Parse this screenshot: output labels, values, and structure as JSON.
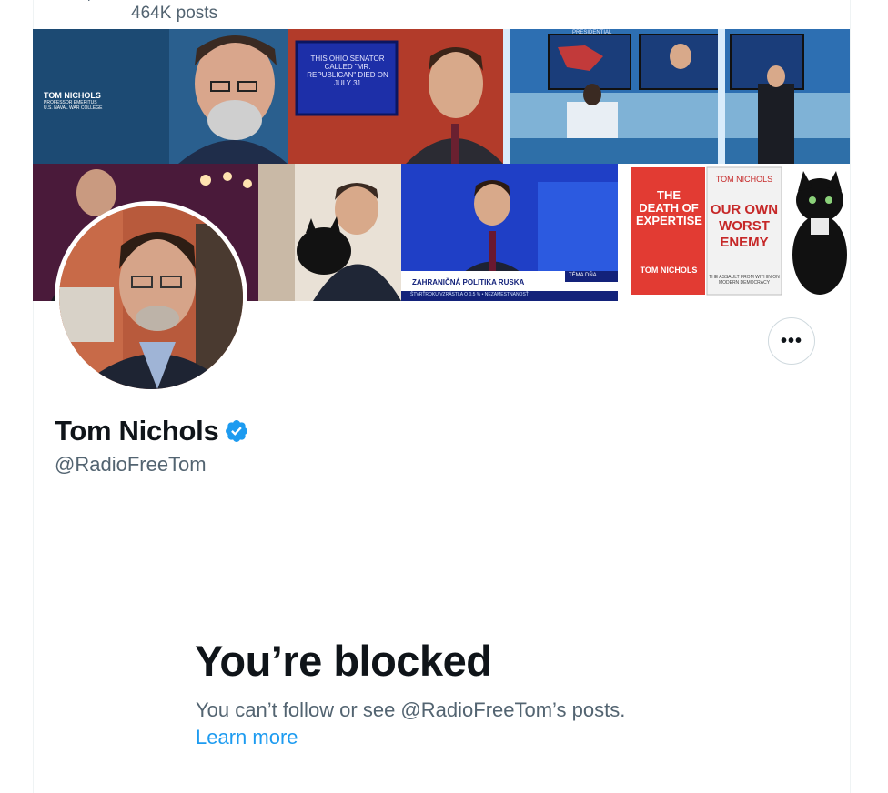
{
  "header": {
    "posts_count": "464K posts"
  },
  "banner": {
    "tiles": [
      {
        "caption_name": "TOM NICHOLS",
        "caption_line2": "PROFESSOR EMERITUS",
        "caption_line3": "U.S. NAVAL WAR COLLEGE"
      },
      {
        "caption_name": "THIS OHIO SENATOR CALLED \"MR. REPUBLICAN\" DIED ON JULY 31"
      },
      {
        "caption_name": "PRESIDENTIAL"
      },
      {
        "caption_name": ""
      },
      {
        "caption_name": ""
      },
      {
        "caption_name": "ZAHRANIČNÁ POLITIKA RUSKA",
        "caption_line2": "TÉMA DŇA",
        "caption_line3": "ŠTVRŤROKU VZRÁSTLA O 0.5 %  •  NEZAMESTNANOSŤ"
      },
      {
        "book1_title": "THE DEATH OF EXPERTISE",
        "book1_author": "TOM NICHOLS",
        "book2_author": "TOM NICHOLS",
        "book2_title": "OUR OWN WORST ENEMY",
        "book2_sub": "THE ASSAULT FROM WITHIN ON MODERN DEMOCRACY"
      }
    ]
  },
  "profile": {
    "display_name": "Tom Nichols",
    "handle": "@RadioFreeTom",
    "more_label": "•••"
  },
  "blocked": {
    "title": "You’re blocked",
    "message": "You can’t follow or see @RadioFreeTom’s posts.",
    "learn_more": "Learn more"
  },
  "colors": {
    "accent": "#1d9bf0",
    "secondary_text": "#536471",
    "primary_text": "#0f1419",
    "border": "#cfd9de"
  }
}
